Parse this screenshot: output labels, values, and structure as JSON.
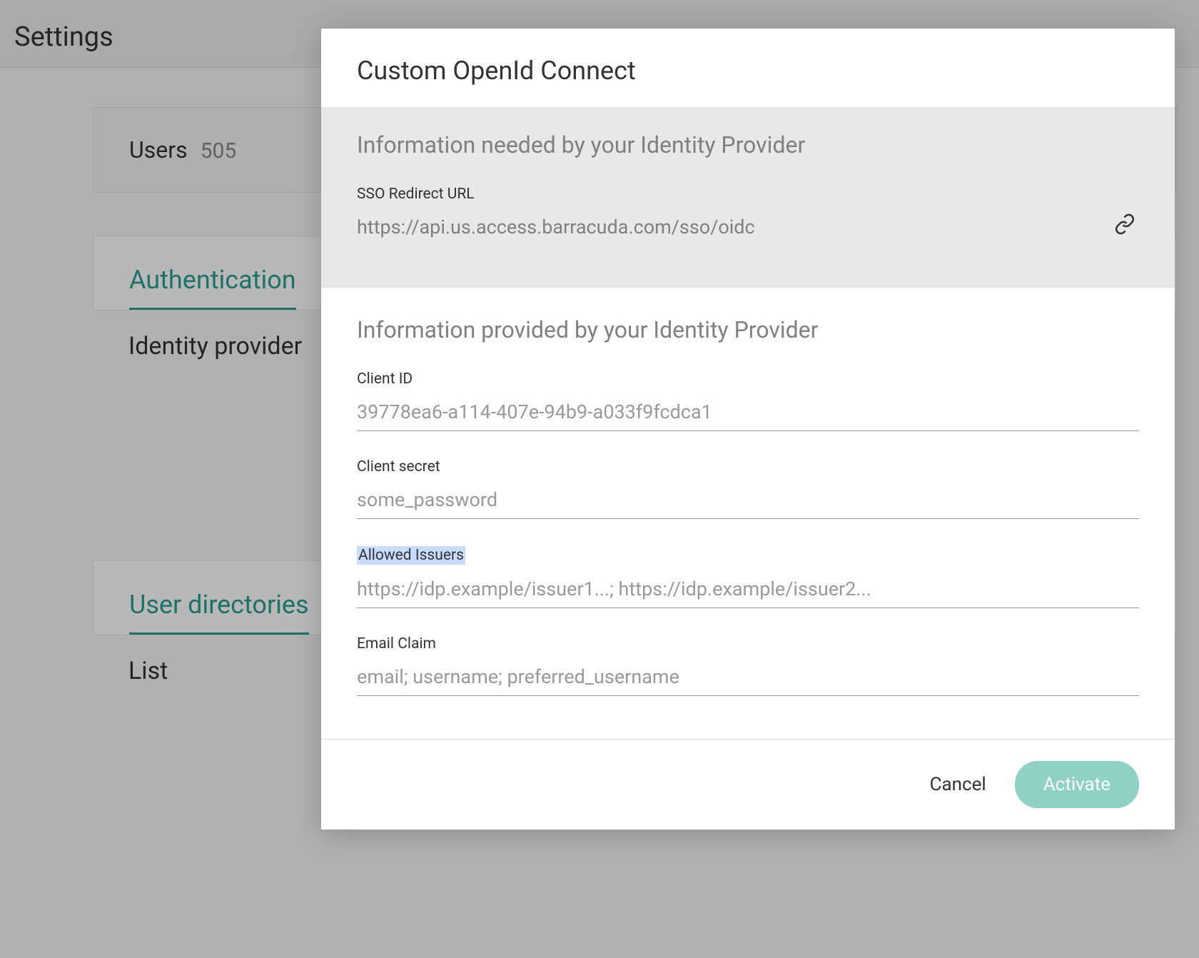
{
  "page": {
    "title": "Settings"
  },
  "users_card": {
    "label": "Users",
    "count": "505"
  },
  "tabs": {
    "authentication": "Authentication",
    "user_directories": "User directories"
  },
  "sections": {
    "identity_provider": "Identity provider",
    "list": "List"
  },
  "modal": {
    "title": "Custom OpenId Connect",
    "section_needed": {
      "title": "Information needed by your Identity Provider",
      "sso_redirect_label": "SSO Redirect URL",
      "sso_redirect_value": "https://api.us.access.barracuda.com/sso/oidc"
    },
    "section_provided": {
      "title": "Information provided by your Identity Provider",
      "client_id_label": "Client ID",
      "client_id_placeholder": "39778ea6-a114-407e-94b9-a033f9fcdca1",
      "client_secret_label": "Client secret",
      "client_secret_placeholder": "some_password",
      "allowed_issuers_label": "Allowed Issuers",
      "allowed_issuers_placeholder": "https://idp.example/issuer1...; https://idp.example/issuer2...",
      "email_claim_label": "Email Claim",
      "email_claim_placeholder": "email; username; preferred_username"
    },
    "footer": {
      "cancel": "Cancel",
      "activate": "Activate"
    }
  }
}
